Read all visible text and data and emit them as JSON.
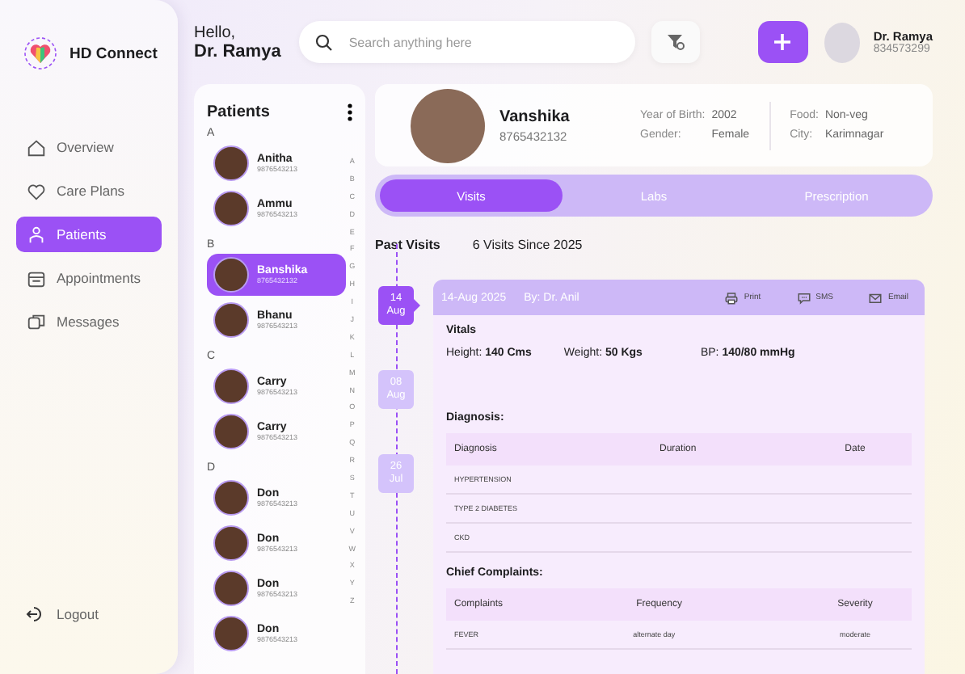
{
  "app": {
    "name": "HD Connect"
  },
  "nav": {
    "items": [
      {
        "label": "Overview",
        "kind": "home",
        "selected": false
      },
      {
        "label": "Care Plans",
        "kind": "care",
        "selected": false
      },
      {
        "label": "Patients",
        "kind": "patients",
        "selected": true
      },
      {
        "label": "Appointments",
        "kind": "calendar",
        "selected": false
      },
      {
        "label": "Messages",
        "kind": "messages",
        "selected": false
      }
    ],
    "logout": "Logout"
  },
  "header": {
    "greeting": "Hello,",
    "user_name": "Dr. Ramya",
    "search": {
      "placeholder": "Search anything here"
    },
    "profile": {
      "name": "Dr. Ramya",
      "phone": "834573299"
    }
  },
  "patients": {
    "title": "Patients",
    "groups": [
      {
        "letter": "A",
        "items": [
          {
            "name": "Anitha",
            "phone": "9876543213",
            "selected": false
          },
          {
            "name": "Ammu",
            "phone": "9876543213",
            "selected": false
          }
        ]
      },
      {
        "letter": "B",
        "items": [
          {
            "name": "Banshika",
            "phone": "8765432132",
            "selected": true
          },
          {
            "name": "Bhanu",
            "phone": "9876543213",
            "selected": false
          }
        ]
      },
      {
        "letter": "C",
        "items": [
          {
            "name": "Carry",
            "phone": "9876543213",
            "selected": false
          },
          {
            "name": "Carry",
            "phone": "9876543213",
            "selected": false
          }
        ]
      },
      {
        "letter": "D",
        "items": [
          {
            "name": "Don",
            "phone": "9876543213",
            "selected": false
          },
          {
            "name": "Don",
            "phone": "9876543213",
            "selected": false
          },
          {
            "name": "Don",
            "phone": "9876543213",
            "selected": false
          },
          {
            "name": "Don",
            "phone": "9876543213",
            "selected": false
          }
        ]
      }
    ],
    "index": [
      "A",
      "B",
      "C",
      "D",
      "E",
      "F",
      "G",
      "H",
      "I",
      "J",
      "K",
      "L",
      "M",
      "N",
      "O",
      "P",
      "Q",
      "R",
      "S",
      "T",
      "U",
      "V",
      "W",
      "X",
      "Y",
      "Z"
    ]
  },
  "patient": {
    "name": "Vanshika",
    "phone": "8765432132",
    "details": [
      {
        "label": "Year of Birth:",
        "value": "2002"
      },
      {
        "label": "Gender:",
        "value": "Female"
      },
      {
        "label": "Food:",
        "value": "Non-veg"
      },
      {
        "label": "City:",
        "value": "Karimnagar"
      }
    ]
  },
  "tabs": [
    {
      "label": "Visits",
      "selected": true
    },
    {
      "label": "Labs",
      "selected": false
    },
    {
      "label": "Prescription",
      "selected": false
    }
  ],
  "visits": {
    "title": "Past Visits",
    "summary": "6 Visits Since 2025",
    "dates": [
      {
        "day": "14",
        "month": "Aug",
        "selected": true
      },
      {
        "day": "08",
        "month": "Aug",
        "selected": false
      },
      {
        "day": "26",
        "month": "Jul",
        "selected": false
      }
    ],
    "card": {
      "date": "14-Aug 2025",
      "doctor": "By: Dr. Anil",
      "actions": [
        {
          "label": "Print",
          "kind": "print"
        },
        {
          "label": "SMS",
          "kind": "sms"
        },
        {
          "label": "Email",
          "kind": "email"
        }
      ],
      "vitals": {
        "title": "Vitals",
        "items": [
          "Height: **140 Cms**",
          "Weight: **50 Kgs**",
          "BP: **140/80 mmHg**"
        ]
      },
      "diagnosis": {
        "title": "Diagnosis:",
        "columns": [
          "Diagnosis",
          "Duration",
          "Date"
        ],
        "rows": [
          [
            "HYPERTENSION"
          ],
          [
            "TYPE 2 DIABETES"
          ],
          [
            "CKD"
          ]
        ]
      },
      "complaints": {
        "title": "Chief Complaints:",
        "columns": [
          "Complaints",
          "Frequency",
          "Severity"
        ],
        "rows": [
          [
            "FEVER",
            "alternate day",
            "moderate"
          ]
        ]
      }
    }
  }
}
